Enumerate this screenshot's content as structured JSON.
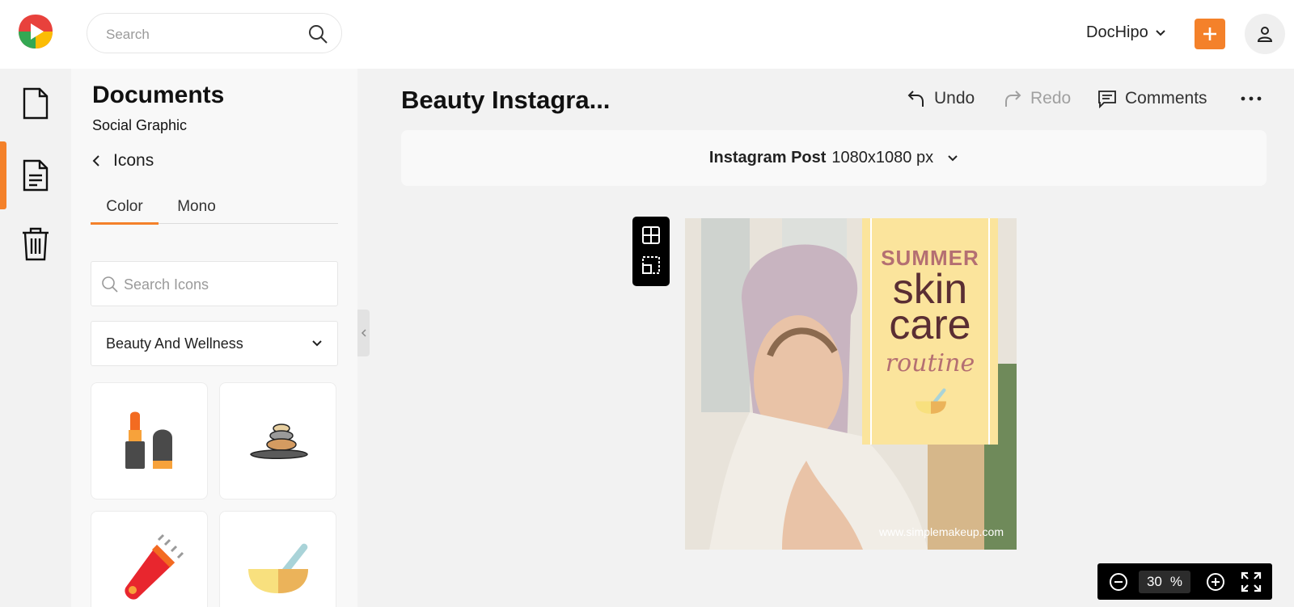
{
  "topbar": {
    "search_placeholder": "Search",
    "account_name": "DocHipo"
  },
  "panel": {
    "title": "Documents",
    "subtitle": "Social Graphic",
    "back_label": "Icons",
    "tabs": [
      {
        "label": "Color"
      },
      {
        "label": "Mono"
      }
    ],
    "icon_search_placeholder": "Search Icons",
    "category": "Beauty And Wellness",
    "icons": [
      {
        "name": "lipstick"
      },
      {
        "name": "spa-stones"
      },
      {
        "name": "hair-trimmer"
      },
      {
        "name": "mortar-pestle"
      }
    ]
  },
  "editor": {
    "doc_title": "Beauty Instagra...",
    "undo_label": "Undo",
    "redo_label": "Redo",
    "comments_label": "Comments",
    "size_name": "Instagram Post",
    "size_value": "1080x1080 px"
  },
  "artwork": {
    "line1": "SUMMER",
    "line2": "skin",
    "line3": "care",
    "line4": "routine",
    "url": "www.simplemakeup.com"
  },
  "zoom": {
    "value": "30",
    "unit": "%"
  },
  "colors": {
    "accent": "#f4812a",
    "banner": "#fbe49c",
    "banner_text": "#5a2e33"
  }
}
